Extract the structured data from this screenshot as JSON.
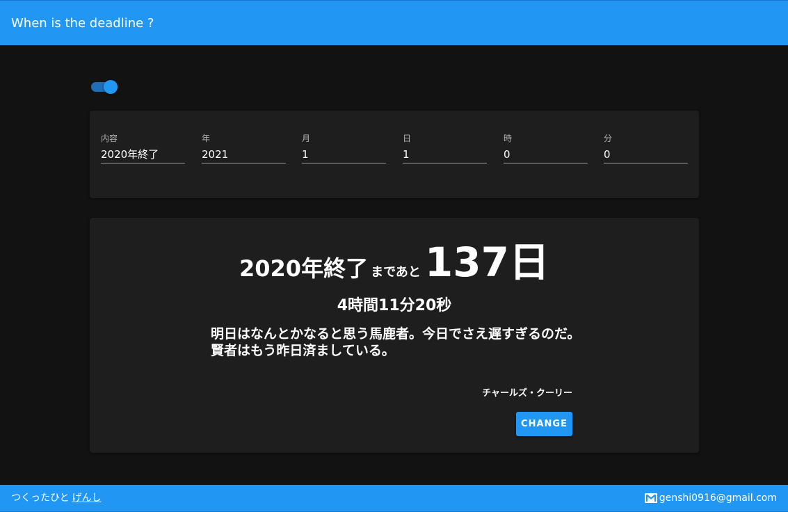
{
  "header": {
    "title": "When is the deadline ?"
  },
  "toggle": {
    "state": "on"
  },
  "form": {
    "fields": [
      {
        "label": "内容",
        "value": "2020年終了"
      },
      {
        "label": "年",
        "value": "2021"
      },
      {
        "label": "月",
        "value": "1"
      },
      {
        "label": "日",
        "value": "1"
      },
      {
        "label": "時",
        "value": "0"
      },
      {
        "label": "分",
        "value": "0"
      }
    ]
  },
  "countdown": {
    "event_name": "2020年終了",
    "made_ato": "まであと",
    "days": "137日",
    "remaining": "4時間11分20秒",
    "quote": "明日はなんとかなると思う馬鹿者。今日でさえ遅すぎるのだ。賢者はもう昨日済ましている。",
    "author": "チャールズ・クーリー",
    "change_label": "CHANGE"
  },
  "footer": {
    "creator_prefix": "つくったひと",
    "creator_name": "げんし",
    "email": "genshi0916@gmail.com",
    "icon": "mail-icon"
  },
  "colors": {
    "accent": "#2196f3",
    "background": "#121212",
    "card": "#1e1e1e"
  }
}
